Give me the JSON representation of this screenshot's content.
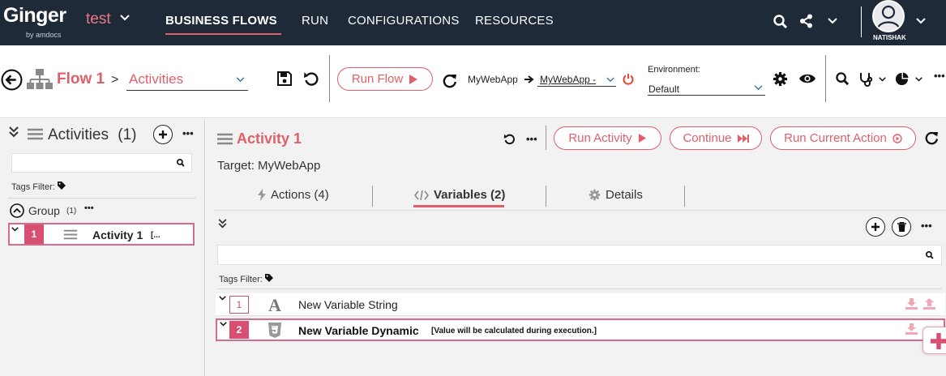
{
  "app": {
    "logo": "Ginger",
    "logo_sub": "by amdocs",
    "solution": "test"
  },
  "nav": {
    "items": [
      "BUSINESS FLOWS",
      "RUN",
      "CONFIGURATIONS",
      "RESOURCES"
    ],
    "user": "NATISHAK"
  },
  "toolbar": {
    "flow_title": "Flow 1",
    "crumb_sep": ">",
    "crumb_value": "Activities",
    "run_flow": "Run Flow",
    "app_name": "MyWebApp",
    "agent_value": "MyWebApp -",
    "env_label": "Environment:",
    "env_value": "Default"
  },
  "left": {
    "title": "Activities",
    "count": "(1)",
    "tags_filter": "Tags Filter:",
    "group_label": "Group",
    "group_count": "(1)",
    "activity_num": "1",
    "activity_name": "Activity 1",
    "activity_suffix": "[..."
  },
  "activity": {
    "title": "Activity 1",
    "target": "Target: MyWebApp",
    "run_activity": "Run Activity",
    "continue": "Continue",
    "run_current_action": "Run Current Action",
    "tabs": [
      "Actions (4)",
      "Variables (2)",
      "Details"
    ]
  },
  "variables": {
    "tags_filter": "Tags Filter:",
    "rows": [
      {
        "num": "1",
        "name": "New Variable String",
        "note": ""
      },
      {
        "num": "2",
        "name": "New Variable Dynamic",
        "note": "[Value will be calculated during execution.]"
      }
    ]
  },
  "colors": {
    "nav_bg": "#1e2a38",
    "accent": "#e0606a",
    "badge": "#d94f72",
    "panel_bg": "#f2f2f2"
  }
}
